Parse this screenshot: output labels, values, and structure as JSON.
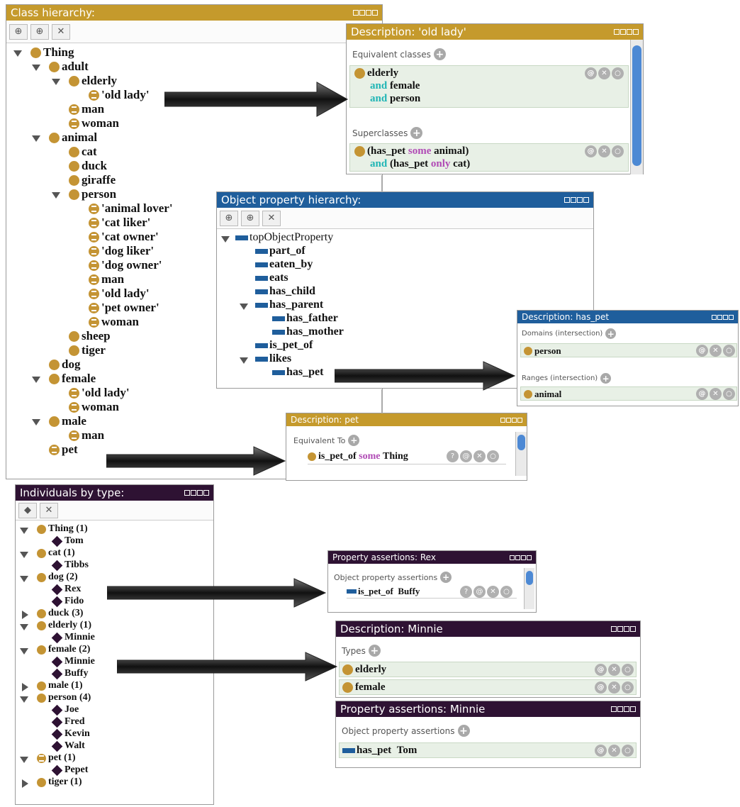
{
  "class_hierarchy": {
    "title": "Class hierarchy:",
    "items": [
      "Thing",
      "adult",
      "elderly",
      "'old lady'",
      "man",
      "woman",
      "animal",
      "cat",
      "duck",
      "giraffe",
      "person",
      "'animal lover'",
      "'cat liker'",
      "'cat owner'",
      "'dog liker'",
      "'dog owner'",
      "man",
      "'old lady'",
      "'pet owner'",
      "woman",
      "sheep",
      "tiger",
      "dog",
      "female",
      "'old lady'",
      "woman",
      "male",
      "man",
      "pet"
    ]
  },
  "desc_old_lady": {
    "title": "Description: 'old lady'",
    "equiv_label": "Equivalent classes",
    "equiv_line1": "elderly",
    "and1": "and",
    "equiv_line2": "female",
    "and2": "and",
    "equiv_line3": "person",
    "super_label": "Superclasses",
    "super_open": "(has_pet",
    "super_some": "some",
    "super_animal": "animal)",
    "and3": "and",
    "super_open2": "(has_pet",
    "super_only": "only",
    "super_cat": "cat)"
  },
  "object_property_hierarchy": {
    "title": "Object property hierarchy:",
    "items": [
      "topObjectProperty",
      "part_of",
      "eaten_by",
      "eats",
      "has_child",
      "has_parent",
      "has_father",
      "has_mother",
      "is_pet_of",
      "likes",
      "has_pet"
    ]
  },
  "desc_has_pet": {
    "title": "Description: has_pet",
    "domains_label": "Domains (intersection)",
    "domain": "person",
    "ranges_label": "Ranges (intersection)",
    "range": "animal"
  },
  "desc_pet": {
    "title": "Description: pet",
    "equiv_label": "Equivalent To",
    "expr_a": "is_pet_of",
    "expr_some": "some",
    "expr_b": "Thing"
  },
  "individuals": {
    "title": "Individuals by type:",
    "items": [
      "Thing (1)",
      "Tom",
      "cat (1)",
      "Tibbs",
      "dog (2)",
      "Rex",
      "Fido",
      "duck (3)",
      "elderly (1)",
      "Minnie",
      "female (2)",
      "Minnie",
      "Buffy",
      "male (1)",
      "person (4)",
      "Joe",
      "Fred",
      "Kevin",
      "Walt",
      "pet (1)",
      "Pepet",
      "tiger (1)"
    ]
  },
  "prop_rex": {
    "title": "Property assertions: Rex",
    "label": "Object property assertions",
    "prop": "is_pet_of",
    "value": "Buffy"
  },
  "desc_minnie": {
    "title": "Description: Minnie",
    "types_label": "Types",
    "type1": "elderly",
    "type2": "female"
  },
  "prop_minnie": {
    "title": "Property assertions: Minnie",
    "label": "Object property assertions",
    "prop": "has_pet",
    "value": "Tom"
  },
  "colors": {
    "class_accent": "#c59a2c",
    "property_accent": "#1f5e9c",
    "individual_accent": "#2e1233"
  }
}
